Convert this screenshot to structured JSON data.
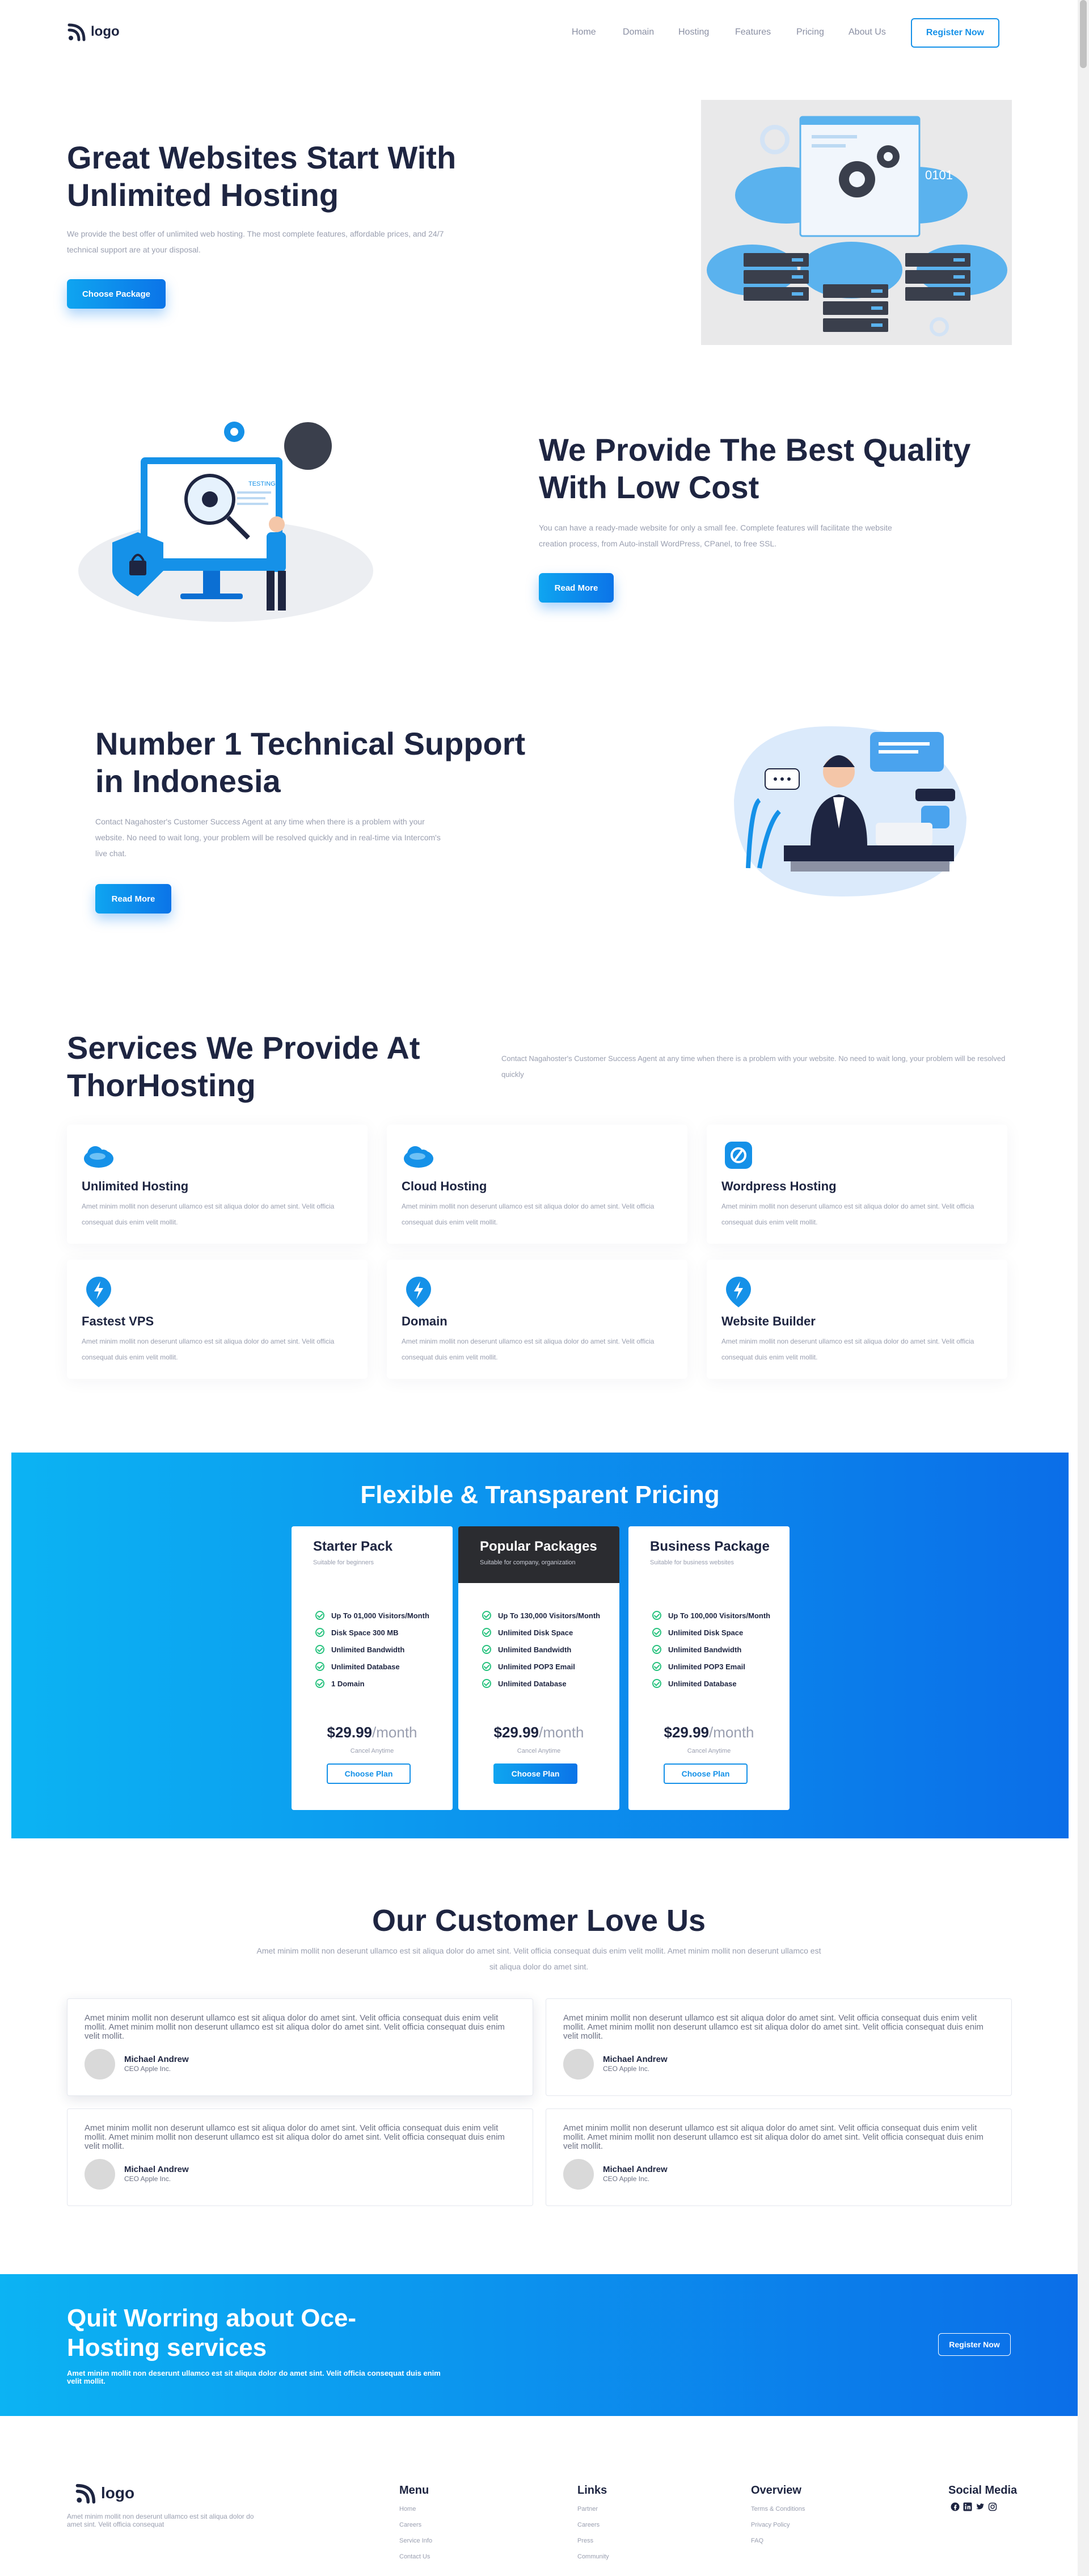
{
  "header": {
    "logo_text": "logo",
    "nav": [
      "Home",
      "Domain",
      "Hosting",
      "Features",
      "Pricing",
      "About Us"
    ],
    "register_label": "Register Now"
  },
  "hero": {
    "title_line1": "Great Websites Start With",
    "title_line2": "Unlimited Hosting",
    "text": "We provide the best offer of unlimited web hosting. The most complete features, affordable prices, and 24/7 technical support are at your disposal.",
    "button_label": "Choose Package",
    "illustration_label": "0101"
  },
  "quality": {
    "title_line1": "We Provide The Best Quality",
    "title_line2": "With Low Cost",
    "text": "You can have a ready-made website for only a small fee. Complete features will facilitate the website creation process, from Auto-install WordPress, CPanel, to free SSL.",
    "button_label": "Read More",
    "illustration_label": "TESTING"
  },
  "support": {
    "title_line1": "Number 1 Technical Support",
    "title_line2": "in Indonesia",
    "text": "Contact Nagahoster's Customer Success Agent at any time when there is a problem with your website. No need to wait long, your problem will be resolved quickly and in real-time via Intercom's live chat.",
    "button_label": "Read More"
  },
  "services": {
    "title_line1": "Services We Provide At",
    "title_line2": "ThorHosting",
    "intro": "Contact Nagahoster's Customer Success Agent at any time when there is a problem with your website. No need to wait long, your problem will be resolved quickly",
    "items": [
      {
        "title": "Unlimited Hosting",
        "text": "Amet minim mollit non deserunt ullamco est sit aliqua dolor do amet sint. Velit officia consequat duis enim velit mollit.",
        "icon": "cloud-icon"
      },
      {
        "title": "Cloud Hosting",
        "text": "Amet minim mollit non deserunt ullamco est sit aliqua dolor do amet sint. Velit officia consequat duis enim velit mollit.",
        "icon": "cloud-icon"
      },
      {
        "title": "Wordpress Hosting",
        "text": "Amet minim mollit non deserunt ullamco est sit aliqua dolor do amet sint. Velit officia consequat duis enim velit mollit.",
        "icon": "wordpress-icon"
      },
      {
        "title": "Fastest VPS",
        "text": "Amet minim mollit non deserunt ullamco est sit aliqua dolor do amet sint. Velit officia consequat duis enim velit mollit.",
        "icon": "lightning-icon"
      },
      {
        "title": "Domain",
        "text": "Amet minim mollit non deserunt ullamco est sit aliqua dolor do amet sint. Velit officia consequat duis enim velit mollit.",
        "icon": "lightning-icon"
      },
      {
        "title": "Website Builder",
        "text": "Amet minim mollit non deserunt ullamco est sit aliqua dolor do amet sint. Velit officia consequat duis enim velit mollit.",
        "icon": "lightning-icon"
      }
    ]
  },
  "pricing": {
    "title": "Flexible & Transparent Pricing",
    "plans": [
      {
        "name": "Starter Pack",
        "subtitle": "Suitable for beginners",
        "features": [
          "Up To 01,000 Visitors/Month",
          "Disk Space 300 MB",
          "Unlimited Bandwidth",
          "Unlimited Database",
          "1 Domain"
        ],
        "price": "$29.99",
        "period": "/month",
        "note": "Cancel Anytime",
        "button": "Choose Plan",
        "highlight": false
      },
      {
        "name": "Popular Packages",
        "subtitle": "Suitable for company, organization",
        "features": [
          "Up To 130,000 Visitors/Month",
          "Unlimited Disk Space",
          "Unlimited Bandwidth",
          "Unlimited POP3 Email",
          "Unlimited Database"
        ],
        "price": "$29.99",
        "period": "/month",
        "note": "Cancel Anytime",
        "button": "Choose Plan",
        "highlight": true
      },
      {
        "name": "Business Package",
        "subtitle": "Suitable for business websites",
        "features": [
          "Up To 100,000 Visitors/Month",
          "Unlimited Disk Space",
          "Unlimited Bandwidth",
          "Unlimited POP3 Email",
          "Unlimited Database"
        ],
        "price": "$29.99",
        "period": "/month",
        "note": "Cancel Anytime",
        "button": "Choose Plan",
        "highlight": false
      }
    ]
  },
  "testimonials": {
    "title": "Our Customer Love Us",
    "subtitle": "Amet minim mollit non deserunt ullamco est sit aliqua dolor do amet sint. Velit officia consequat duis enim velit mollit. Amet minim mollit non deserunt ullamco est sit aliqua dolor do amet sint.",
    "items": [
      {
        "text": "Amet minim mollit non deserunt ullamco est sit aliqua dolor do amet sint. Velit officia consequat duis enim velit mollit. Amet minim mollit non deserunt ullamco est sit aliqua dolor do amet sint. Velit officia consequat duis enim velit mollit.",
        "name": "Michael Andrew",
        "role": "CEO Apple Inc."
      },
      {
        "text": "Amet minim mollit non deserunt ullamco est sit aliqua dolor do amet sint. Velit officia consequat duis enim velit mollit. Amet minim mollit non deserunt ullamco est sit aliqua dolor do amet sint. Velit officia consequat duis enim velit mollit.",
        "name": "Michael Andrew",
        "role": "CEO Apple Inc."
      },
      {
        "text": "Amet minim mollit non deserunt ullamco est sit aliqua dolor do amet sint. Velit officia consequat duis enim velit mollit. Amet minim mollit non deserunt ullamco est sit aliqua dolor do amet sint. Velit officia consequat duis enim velit mollit.",
        "name": "Michael Andrew",
        "role": "CEO Apple Inc."
      },
      {
        "text": "Amet minim mollit non deserunt ullamco est sit aliqua dolor do amet sint. Velit officia consequat duis enim velit mollit. Amet minim mollit non deserunt ullamco est sit aliqua dolor do amet sint. Velit officia consequat duis enim velit mollit.",
        "name": "Michael Andrew",
        "role": "CEO Apple Inc."
      }
    ]
  },
  "cta": {
    "title_line1": "Quit Worring about Oce-",
    "title_line2": "Hosting services",
    "text": "Amet minim mollit non deserunt ullamco est sit aliqua dolor do amet sint. Velit officia consequat duis enim velit mollit.",
    "button_label": "Register Now"
  },
  "footer": {
    "logo_text": "logo",
    "text": "Amet minim mollit non deserunt ullamco est sit aliqua dolor do amet sint. Velit officia consequat",
    "menu": {
      "title": "Menu",
      "items": [
        "Home",
        "Careers",
        "Service Info",
        "Contact Us"
      ]
    },
    "links": {
      "title": "Links",
      "items": [
        "Partner",
        "Careers",
        "Press",
        "Community"
      ]
    },
    "overview": {
      "title": "Overview",
      "items": [
        "Terms & Conditions",
        "Privacy Policy",
        "FAQ"
      ]
    },
    "social": {
      "title": "Social Media",
      "icons": [
        "facebook-icon",
        "linkedin-icon",
        "twitter-icon",
        "instagram-icon"
      ]
    }
  },
  "colors": {
    "primary": "#0b74e8",
    "primary_light": "#0fb4f2",
    "dark": "#1e2541",
    "muted": "#9a9fb0",
    "success": "#27c27e"
  }
}
